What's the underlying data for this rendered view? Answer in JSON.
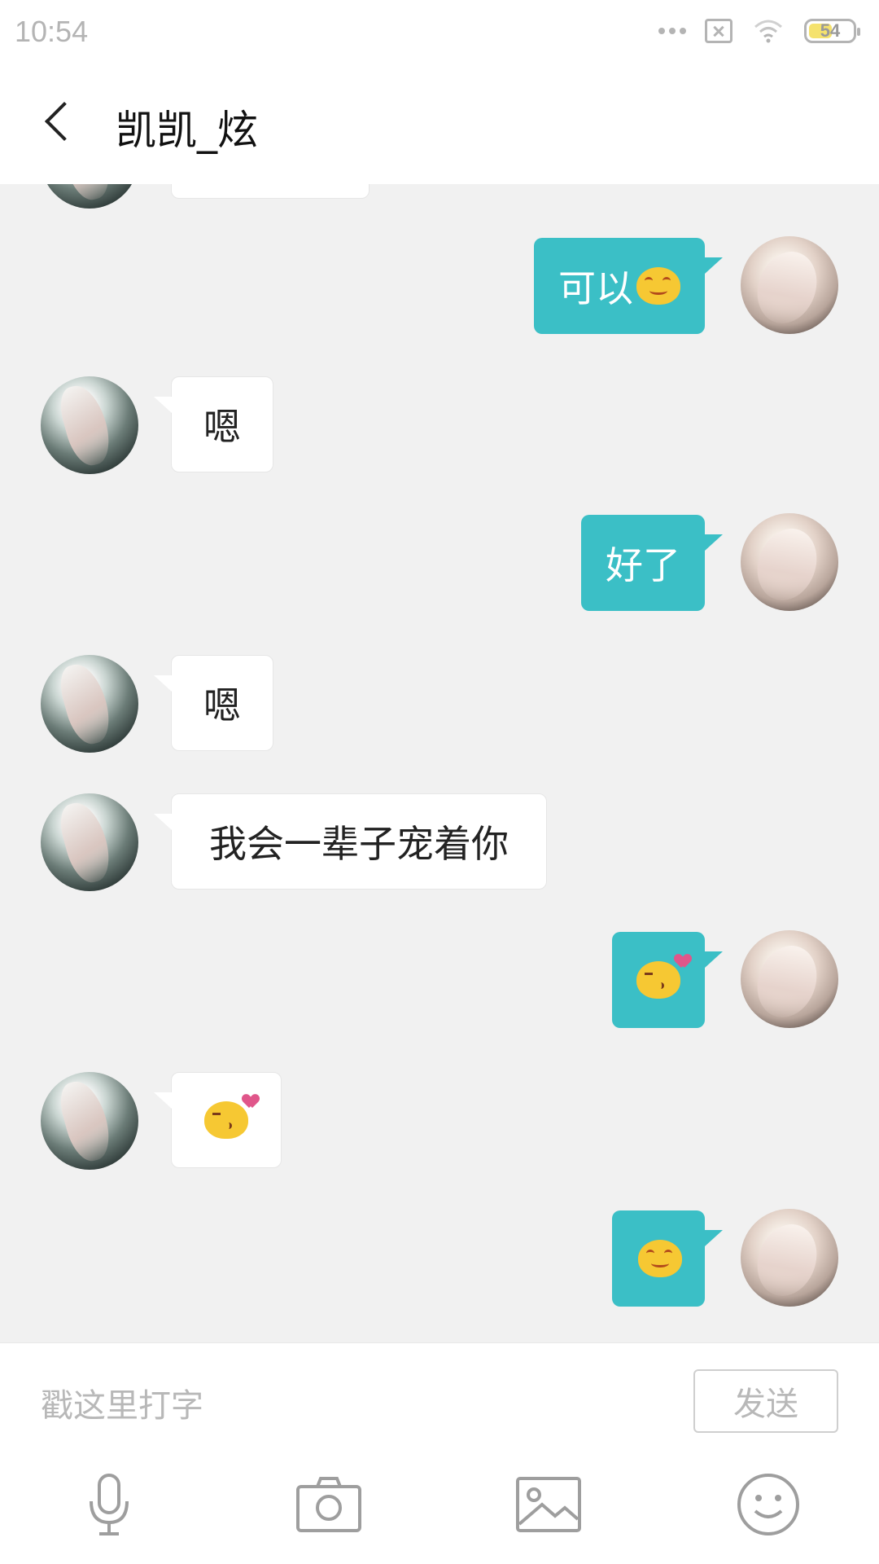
{
  "status_bar": {
    "time": "10:54",
    "battery": "54",
    "battery_level": 0.54,
    "icons": [
      "more-dots-icon",
      "sim-off-icon",
      "wifi-icon",
      "battery-icon"
    ]
  },
  "header": {
    "title": "凯凯_炫",
    "back_icon": "chevron-left-icon"
  },
  "messages": [
    {
      "from": "me",
      "text": "可以",
      "emoji": "smiling-face-icon"
    },
    {
      "from": "them",
      "text": "嗯"
    },
    {
      "from": "me",
      "text": "好了"
    },
    {
      "from": "them",
      "text": "嗯"
    },
    {
      "from": "them",
      "text": "我会一辈子宠着你"
    },
    {
      "from": "me",
      "emoji": "kissing-face-heart-icon"
    },
    {
      "from": "them",
      "emoji": "kissing-face-heart-icon"
    },
    {
      "from": "me",
      "emoji": "smiling-face-icon"
    }
  ],
  "composer": {
    "placeholder": "戳这里打字",
    "send_label": "发送"
  },
  "toolbar": {
    "items": [
      "microphone-icon",
      "camera-icon",
      "image-icon",
      "emoji-icon"
    ]
  },
  "colors": {
    "my_bubble": "#3bbfc6",
    "their_bubble": "#ffffff",
    "chat_background": "#f1f1f1",
    "battery_fill": "#f5e26d"
  }
}
